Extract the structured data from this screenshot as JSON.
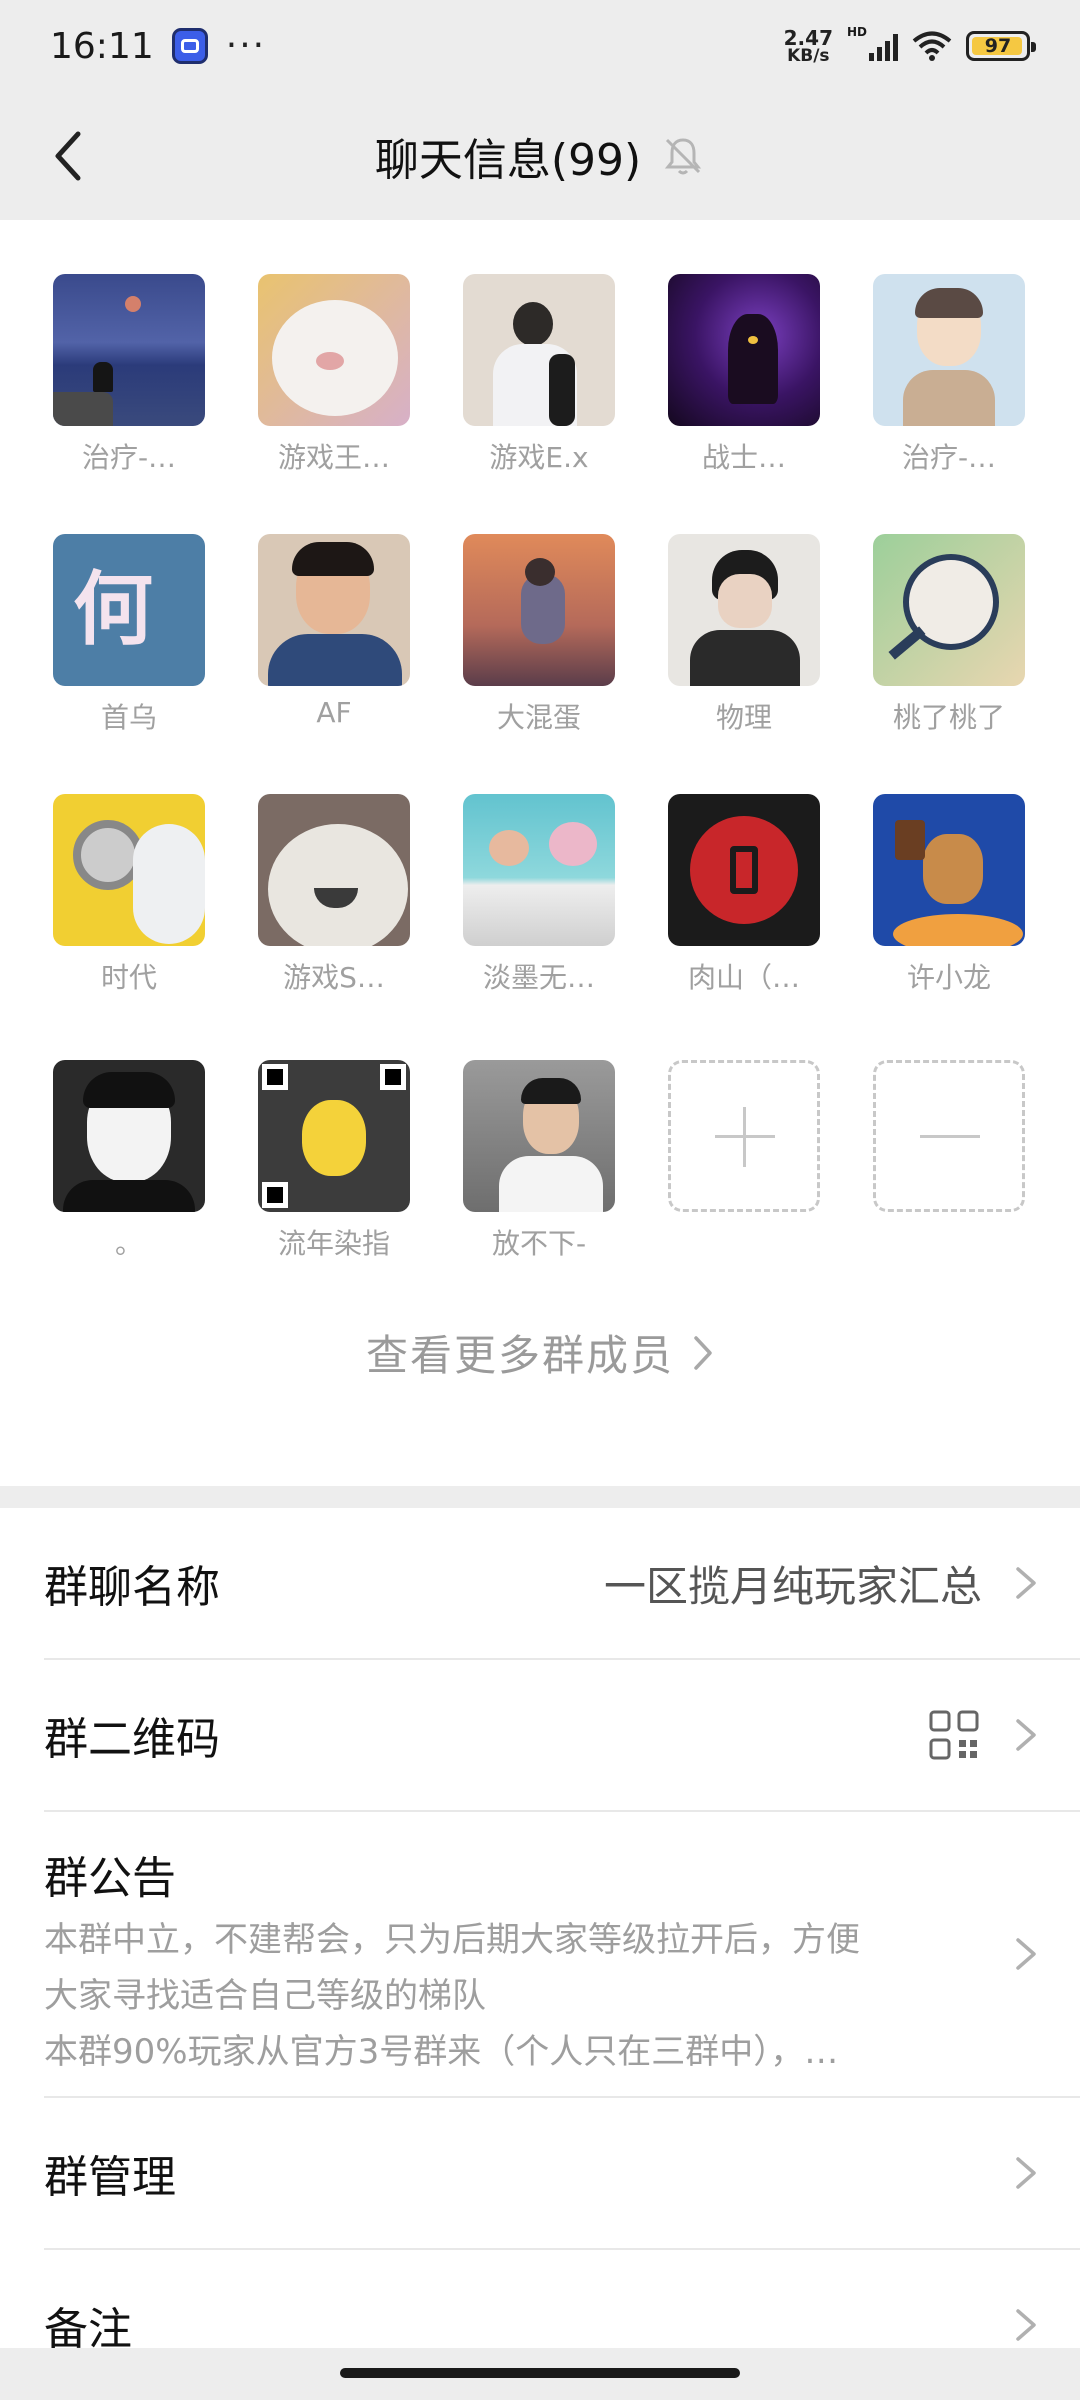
{
  "status_bar": {
    "time": "16:11",
    "dots": "···",
    "speed_value": "2.47",
    "speed_unit": "KB/s",
    "network_tag": "HD",
    "battery": "97",
    "app_icon": "message-app-icon",
    "wifi_icon": "wifi-icon",
    "signal_icon": "cell-signal-icon"
  },
  "header": {
    "title": "聊天信息(99)",
    "back_icon": "chevron-left-icon",
    "mute_icon": "bell-off-icon"
  },
  "members": [
    {
      "name": "治疗-…"
    },
    {
      "name": "游戏王…"
    },
    {
      "name": "游戏E.x"
    },
    {
      "name": "战士…"
    },
    {
      "name": "治疗-…"
    },
    {
      "name": "首乌"
    },
    {
      "name": "AF"
    },
    {
      "name": "大混蛋"
    },
    {
      "name": "物理"
    },
    {
      "name": "桃了桃了"
    },
    {
      "name": "时代"
    },
    {
      "name": "游戏S…"
    },
    {
      "name": "淡墨无…"
    },
    {
      "name": "肉山（…"
    },
    {
      "name": "许小龙"
    },
    {
      "name": "。"
    },
    {
      "name": "流年染指"
    },
    {
      "name": "放不下-"
    }
  ],
  "member_actions": {
    "add_icon": "plus-icon",
    "remove_icon": "minus-icon"
  },
  "more_members_label": "查看更多群成员",
  "settings": {
    "group_name_label": "群聊名称",
    "group_name_value": "一区揽月纯玩家汇总",
    "qr_label": "群二维码",
    "qr_icon": "qr-code-icon",
    "notice_label": "群公告",
    "notice_lines": [
      "本群中立，不建帮会，只为后期大家等级拉开后，方便",
      "大家寻找适合自己等级的梯队",
      "本群90%玩家从官方3号群来（个人只在三群中），…"
    ],
    "manage_label": "群管理",
    "remark_label": "备注"
  },
  "colors": {
    "background": "#ededed",
    "panel": "#ffffff",
    "muted_text": "#a0a0a0",
    "battery_fill": "#f5c842"
  }
}
